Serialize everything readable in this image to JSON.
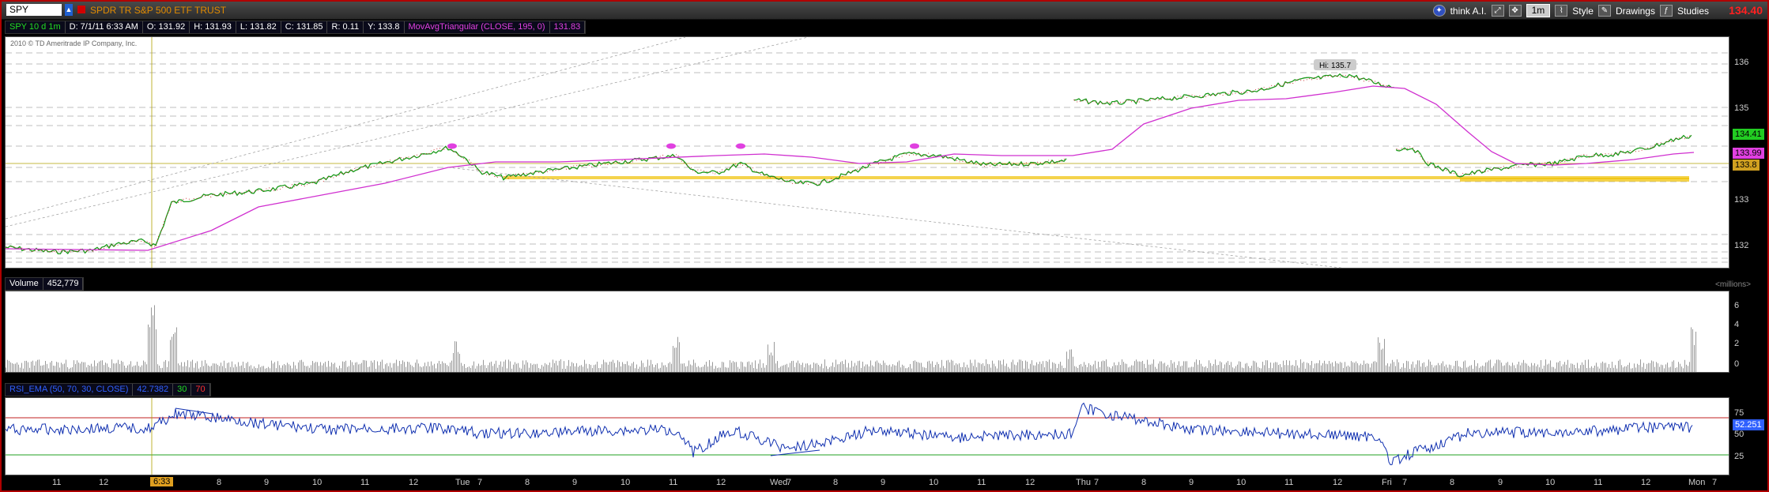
{
  "toolbar": {
    "symbol": "SPY",
    "description": "SPDR TR S&P 500 ETF TRUST",
    "last_price": "134.40",
    "think_ai": "think A.I.",
    "interval": "1m",
    "style": "Style",
    "drawings": "Drawings",
    "studies": "Studies"
  },
  "price_header": {
    "symbol": "SPY 10 d 1m",
    "date": "D: 7/1/11 6:33 AM",
    "open": "O: 131.92",
    "high": "H: 131.93",
    "low": "L: 131.82",
    "close": "C: 131.85",
    "range": "R: 0.11",
    "y": "Y: 133.8",
    "study": "MovAvgTriangular (CLOSE, 195, 0)",
    "study_value": "131.83"
  },
  "copyright": "2010 © TD Ameritrade IP Company, Inc.",
  "hi_label": "Hi: 135.7",
  "price_axis": [
    "136",
    "135",
    "134",
    "133",
    "132"
  ],
  "price_badges": [
    {
      "value": "134.41",
      "color": "#22cc22"
    },
    {
      "value": "133.99",
      "color": "#e040e0"
    },
    {
      "value": "133.8",
      "color": "#d0a020"
    }
  ],
  "volume_header": {
    "label": "Volume",
    "value": "452,779"
  },
  "volume_axis_units": "<millions>",
  "volume_axis": [
    "6",
    "4",
    "2",
    "0"
  ],
  "rsi_header": {
    "label": "RSI_EMA (50, 70, 30, CLOSE)",
    "value": "42.7382",
    "oversold": "30",
    "overbought": "70"
  },
  "rsi_axis": [
    "75",
    "50",
    "25"
  ],
  "rsi_badge": "52.251",
  "cursor_time": "6:33",
  "time_axis": [
    "11",
    "12",
    "8",
    "9",
    "10",
    "11",
    "12",
    "Tue",
    "7",
    "8",
    "9",
    "10",
    "11",
    "12",
    "Wed",
    "7",
    "8",
    "9",
    "10",
    "11",
    "12",
    "Thu",
    "7",
    "8",
    "9",
    "10",
    "11",
    "12",
    "Fri",
    "7",
    "8",
    "9",
    "10",
    "11",
    "12",
    "Mon",
    "7"
  ],
  "colors": {
    "price_up": "#1a9a1a",
    "price_down": "#c01010",
    "mavg": "#d030d0",
    "rsi_line": "#1030b0",
    "rsi_upper": "#c02020",
    "rsi_lower": "#20a020",
    "support_band": "#f0c000"
  }
}
